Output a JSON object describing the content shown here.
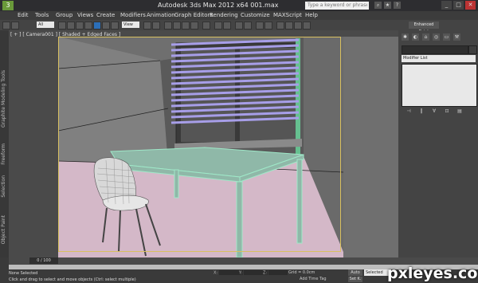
{
  "window": {
    "title": "Autodesk 3ds Max  2012 x64      001.max",
    "logo": "3",
    "search_placeholder": "Type a keyword or phrase",
    "controls": [
      "_",
      "□",
      "✕"
    ]
  },
  "menu": {
    "items": [
      "Edit",
      "Tools",
      "Group",
      "Views",
      "Create",
      "Modifiers",
      "Animation",
      "Graph Editors",
      "Rendering",
      "Customize",
      "MAXScript",
      "Help"
    ]
  },
  "toolbar": {
    "filter_value": "All",
    "coord_value": "View",
    "enhanced_label": "Enhanced Paint"
  },
  "left_tabs": {
    "graphite": "Graphite Modeling Tools",
    "freeform": "Freeform",
    "selection": "Selection",
    "object_paint": "Object Paint"
  },
  "viewport": {
    "label": "[ + ] [ Camera001 ] [ Shaded + Edged Faces ]"
  },
  "command_panel": {
    "modifier_list": "Modifier List"
  },
  "timeline": {
    "frame_counter": "0 / 100"
  },
  "status": {
    "selection": "None Selected",
    "prompt": "Click and drag to select and move objects (Ctrl: select multiple)",
    "x_label": "X:",
    "y_label": "Y:",
    "z_label": "Z:",
    "grid": "Grid = 0.0cm",
    "add_time_tag": "Add Time Tag",
    "auto_key": "Auto",
    "set_key": "Set K.",
    "selected_filter": "Selected"
  },
  "watermark": "pxleyes.com",
  "colors": {
    "window_frame": "#2d2d30",
    "viewport_bg": "#4a4a4a",
    "floor": "#d4b8c8",
    "blinds": "#9f96e0",
    "table": "#9fd8c8",
    "chair": "#d8d8d8",
    "selection_border": "#d8c060"
  }
}
